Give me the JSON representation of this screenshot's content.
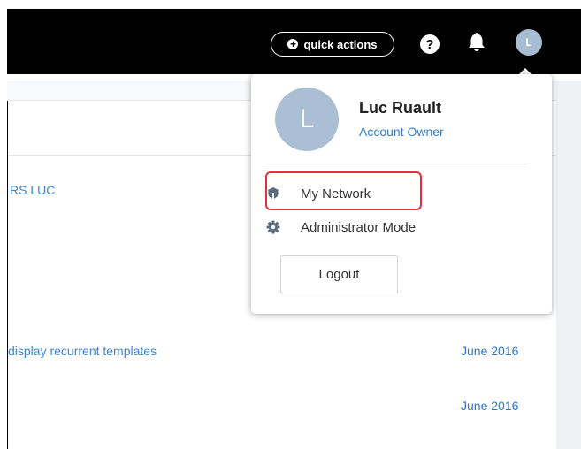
{
  "header": {
    "quick_actions_label": "quick actions",
    "avatar_initial": "L"
  },
  "content": {
    "link_partial_1": "RS LUC",
    "link_partial_2": "display recurrent templates",
    "date_1": "June 2016",
    "date_2": "June 2016"
  },
  "dropdown": {
    "avatar_initial": "L",
    "user_name": "Luc Ruault",
    "user_role": "Account Owner",
    "items": [
      {
        "label": "My Network",
        "icon": "network-icon"
      },
      {
        "label": "Administrator Mode",
        "icon": "gear-icon"
      }
    ],
    "logout_label": "Logout"
  },
  "colors": {
    "topbar": "#000000",
    "link": "#3a86d9",
    "avatar": "#aabfd4",
    "highlight": "#e5313a"
  }
}
